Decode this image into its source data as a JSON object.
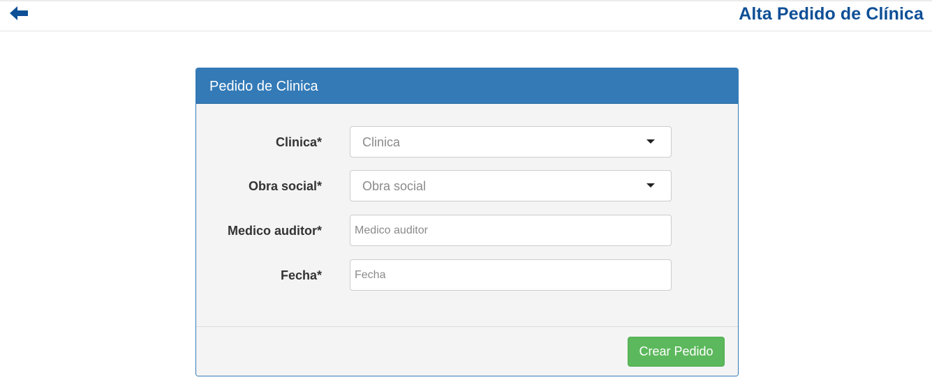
{
  "header": {
    "title": "Alta Pedido de Clínica",
    "back_icon": "arrow-left-icon",
    "title_color": "#0e4f96"
  },
  "panel": {
    "heading": "Pedido de Clinica",
    "heading_color": "#337ab7",
    "fields": {
      "clinica": {
        "label": "Clinica*",
        "placeholder": "Clinica",
        "value": ""
      },
      "obra_social": {
        "label": "Obra social*",
        "placeholder": "Obra social",
        "value": ""
      },
      "medico_auditor": {
        "label": "Medico auditor*",
        "placeholder": "Medico auditor",
        "value": ""
      },
      "fecha": {
        "label": "Fecha*",
        "placeholder": "Fecha",
        "value": ""
      }
    },
    "submit_label": "Crear Pedido",
    "submit_color": "#5cb85c"
  }
}
